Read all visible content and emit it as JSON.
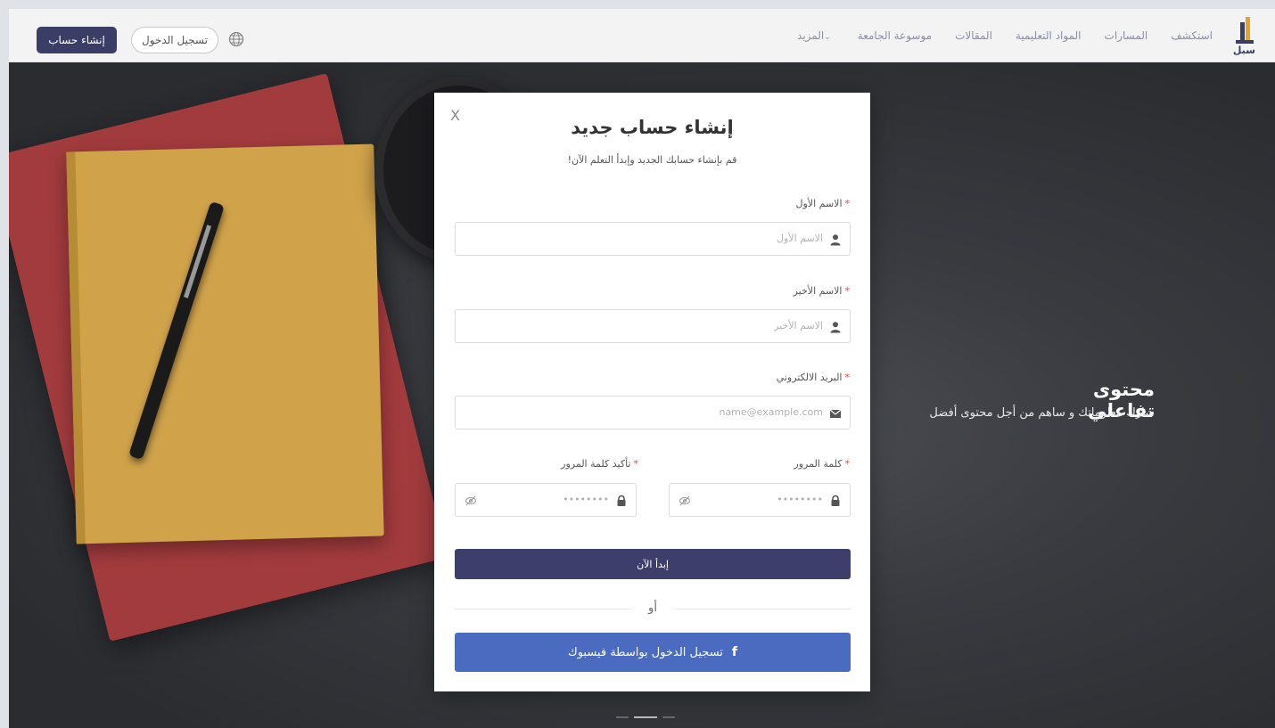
{
  "header": {
    "logo_text": "سبل",
    "nav": [
      {
        "label": "استكشف"
      },
      {
        "label": "المسارات"
      },
      {
        "label": "المواد التعليمية"
      },
      {
        "label": "المقالات"
      },
      {
        "label": "موسوعة الجامعة"
      },
      {
        "label": "المزيد"
      }
    ],
    "more_chevron": "⌄",
    "login_label": "تسجيل الدخول",
    "signup_label": "إنشاء حساب",
    "globe_icon": "globe-icon"
  },
  "hero": {
    "title": "محتوى تفاعلي",
    "subtitle": "شارك معلوماتك و ساهم من أجل محتوى أفضل"
  },
  "modal": {
    "close": "X",
    "title": "إنشاء حساب جديد",
    "subtitle": "قم بإنشاء حسابك الجديد وإبدأ التعلم الآن!",
    "required_mark": "*",
    "first_name": {
      "label": "الاسم الأول",
      "placeholder": "الاسم الأول"
    },
    "last_name": {
      "label": "الاسم الأخير",
      "placeholder": "الاسم الأخير"
    },
    "email": {
      "label": "البريد الالكتروني",
      "placeholder": "name@example.com"
    },
    "password": {
      "label": "كلمة المرور",
      "placeholder": "••••••••"
    },
    "confirm_password": {
      "label": "تأكيد كلمة المرور",
      "placeholder": "••••••••"
    },
    "submit_label": "إبدأ الآن",
    "or_label": "أو",
    "facebook_label": "تسجيل الدخول بواسطة فيسبوك",
    "facebook_glyph": "f"
  },
  "colors": {
    "primary": "#3e3e6c",
    "facebook": "#4b6bc0",
    "required": "#e04b4b",
    "logo_accent": "#e2a52a"
  }
}
